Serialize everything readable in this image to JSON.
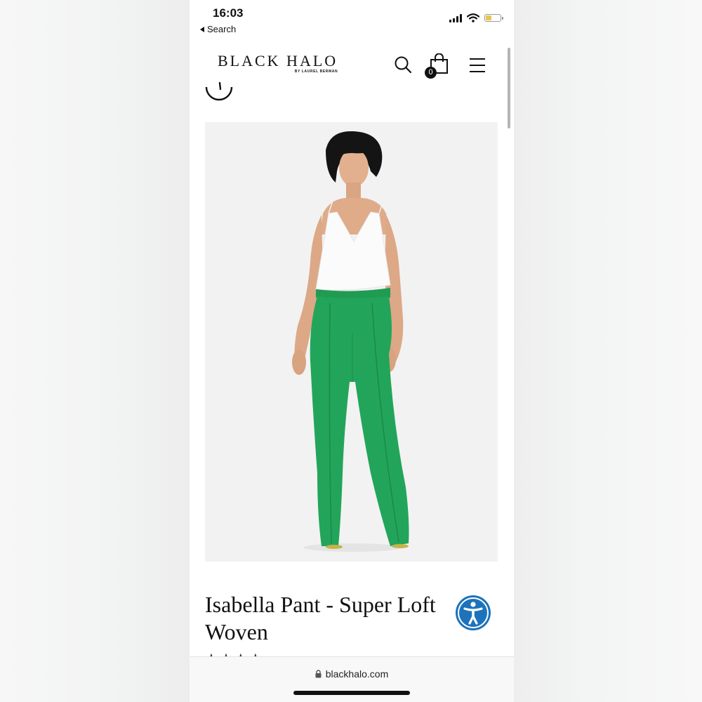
{
  "status_bar": {
    "time": "16:03",
    "back_label": "Search"
  },
  "header": {
    "logo": "BLACK HALO",
    "logo_sub": "BY LAUREL BERMAN",
    "cart_count": "0",
    "icons": [
      "search-icon",
      "shopping-bag-icon",
      "hamburger-menu-icon"
    ]
  },
  "product": {
    "title": "Isabella Pant - Super Loft Woven",
    "photo_colors": {
      "pants": "#22a55a",
      "top": "#ffffff",
      "background": "#f2f2f2"
    }
  },
  "browser": {
    "url": "blackhalo.com"
  },
  "colors": {
    "accessibility": "#1c73bb"
  }
}
